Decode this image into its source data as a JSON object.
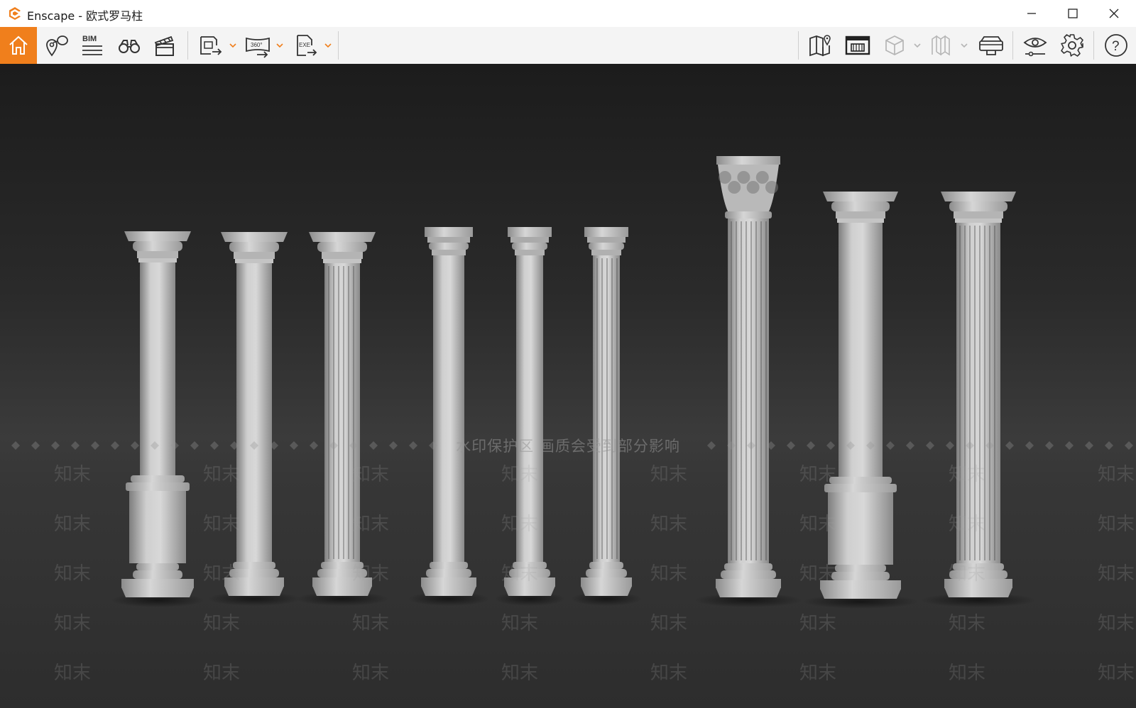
{
  "window": {
    "app_name": "Enscape",
    "title": "Enscape - 欧式罗马柱",
    "controls": [
      "minimize",
      "maximize",
      "close"
    ]
  },
  "toolbar": {
    "left_items": [
      {
        "id": "home",
        "icon": "home-icon",
        "active": true
      },
      {
        "id": "views",
        "icon": "view-management-icon"
      },
      {
        "id": "bim",
        "icon": "bim-icon",
        "label": "BIM"
      },
      {
        "id": "assets",
        "icon": "binoculars-icon"
      },
      {
        "id": "video",
        "icon": "clapperboard-icon"
      },
      {
        "id": "screenshot",
        "icon": "render-export-icon",
        "has_dropdown": true
      },
      {
        "id": "panorama",
        "icon": "panorama-360-icon",
        "label": "360°",
        "has_dropdown": true
      },
      {
        "id": "exe",
        "icon": "exe-export-icon",
        "label": "EXE",
        "has_dropdown": true
      }
    ],
    "right_items": [
      {
        "id": "map",
        "icon": "map-icon"
      },
      {
        "id": "minimap",
        "icon": "minimap-icon"
      },
      {
        "id": "section",
        "icon": "cube-icon",
        "has_dropdown": true,
        "disabled": true
      },
      {
        "id": "orthographic",
        "icon": "orthographic-icon",
        "has_dropdown": true,
        "disabled": true
      },
      {
        "id": "vr",
        "icon": "vr-headset-icon"
      },
      {
        "id": "visual_settings",
        "icon": "eye-settings-icon"
      },
      {
        "id": "settings",
        "icon": "gear-icon"
      },
      {
        "id": "help",
        "icon": "help-icon",
        "label": "?"
      }
    ],
    "accent_color": "#f07f1c"
  },
  "viewport": {
    "watermark": "水印保护区  画质会受到部分影响",
    "watermark_tiles": "知末"
  }
}
